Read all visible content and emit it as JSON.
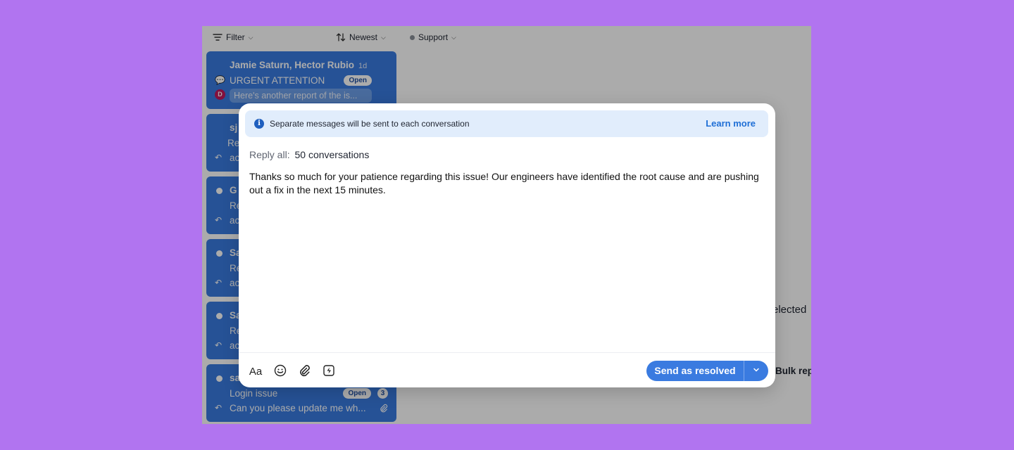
{
  "toolbar": {
    "filter_label": "Filter",
    "sort_label": "Newest",
    "inbox_label": "Support"
  },
  "conversations": [
    {
      "name": "Jamie Saturn, Hector Rubio",
      "time": "1d",
      "subject": "URGENT ATTENTION",
      "status": "Open",
      "preview": "Here's another report of the is...",
      "avatar_initial": "D"
    },
    {
      "name": "sj",
      "subject": "Re",
      "preview": "ac"
    },
    {
      "name": "G",
      "subject": "Re",
      "preview": "ac"
    },
    {
      "name": "Sa",
      "subject": "Re",
      "preview": "ac"
    },
    {
      "name": "Sa",
      "subject": "Re",
      "preview": "ac"
    },
    {
      "name": "sa",
      "subject": "Login issue",
      "status": "Open",
      "count": "3",
      "preview": "Can you please update me wh..."
    }
  ],
  "main": {
    "selected_text": "elected",
    "bulk_reply_label": "Bulk repl"
  },
  "modal": {
    "banner_text": "Separate messages will be sent to each conversation",
    "learn_more": "Learn more",
    "reply_all_label": "Reply all:",
    "reply_all_value": "50 conversations",
    "message": "Thanks so much for your patience regarding this issue! Our engineers have identified the root cause and are pushing out a fix in the next 15 minutes.",
    "format_label": "Aa",
    "send_label": "Send as resolved"
  },
  "colors": {
    "background": "#b174f0",
    "accent": "#3a7be0",
    "banner": "#e1edfc",
    "link": "#1f6fd6"
  }
}
